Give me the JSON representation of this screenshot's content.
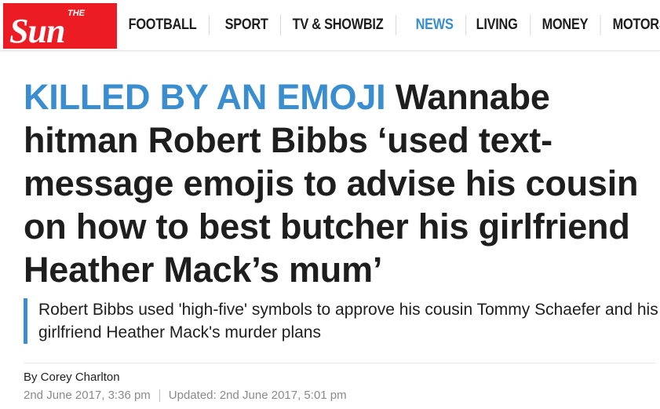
{
  "brand": {
    "logo_small_text": "THE",
    "logo_text": "Sun",
    "logo_bg_color": "#eb1c24"
  },
  "nav": {
    "items": [
      {
        "label": "FOOTBALL",
        "active": false
      },
      {
        "label": "SPORT",
        "active": false
      },
      {
        "label": "TV & SHOWBIZ",
        "active": false
      },
      {
        "label": "NEWS",
        "active": true
      },
      {
        "label": "LIVING",
        "active": false
      },
      {
        "label": "MONEY",
        "active": false
      },
      {
        "label": "MOTORS",
        "active": false
      }
    ]
  },
  "article": {
    "kicker": "KILLED BY AN EMOJI",
    "headline": "Wannabe hitman Robert Bibbs ‘used text-message emojis to advise his cousin on how to best butcher his girlfriend Heather Mack’s mum’",
    "standfirst": "Robert Bibbs used 'high-five' symbols to approve his cousin Tommy Schaefer and his girlfriend Heather Mack's murder plans",
    "byline": "By Corey Charlton",
    "published": "2nd June 2017, 3:36 pm",
    "updated": "Updated: 2nd June 2017, 5:01 pm"
  },
  "colors": {
    "accent": "#3a8dce",
    "text": "#1e1e1e",
    "muted": "#8a8a8a"
  }
}
